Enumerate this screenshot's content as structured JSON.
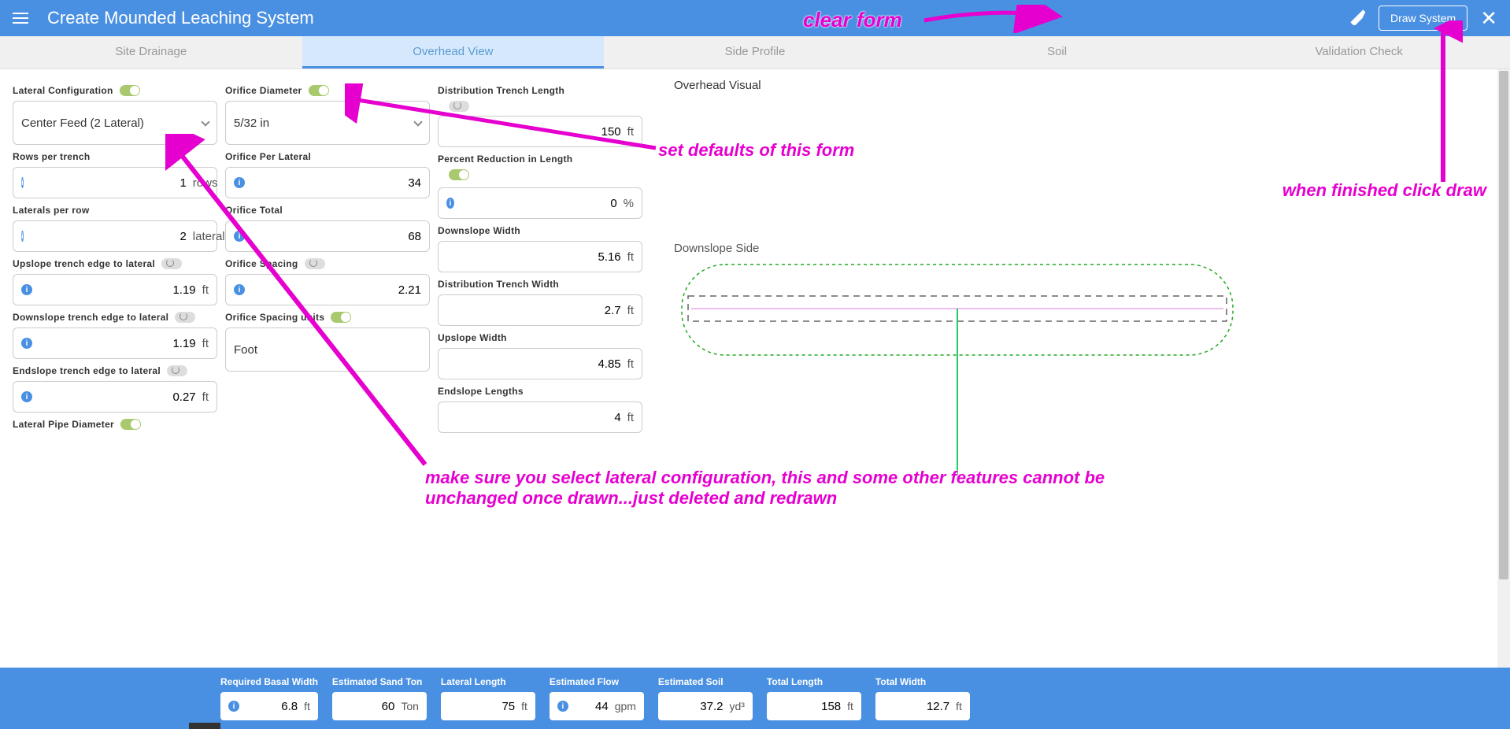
{
  "header": {
    "title": "Create Mounded Leaching System",
    "draw_button": "Draw System"
  },
  "tabs": [
    "Site Drainage",
    "Overhead View",
    "Side Profile",
    "Soil",
    "Validation Check"
  ],
  "active_tab": 1,
  "col1": {
    "lateral_config_label": "Lateral Configuration",
    "lateral_config_value": "Center Feed (2 Lateral)",
    "rows_per_trench_label": "Rows per trench",
    "rows_per_trench_value": "1",
    "rows_per_trench_unit": "rows",
    "laterals_per_row_label": "Laterals per row",
    "laterals_per_row_value": "2",
    "laterals_per_row_unit": "laterals/row",
    "upslope_label": "Upslope trench edge to lateral",
    "upslope_value": "1.19",
    "downslope_label": "Downslope trench edge to lateral",
    "downslope_value": "1.19",
    "endslope_label": "Endslope trench edge to lateral",
    "endslope_value": "0.27",
    "lateral_pipe_label": "Lateral Pipe Diameter",
    "ft": "ft"
  },
  "col2": {
    "orifice_diameter_label": "Orifice Diameter",
    "orifice_diameter_value": "5/32 in",
    "orifice_per_lateral_label": "Orifice Per Lateral",
    "orifice_per_lateral_value": "34",
    "orifice_total_label": "Orifice Total",
    "orifice_total_value": "68",
    "orifice_spacing_label": "Orifice Spacing",
    "orifice_spacing_value": "2.21",
    "orifice_spacing_units_label": "Orifice Spacing units",
    "orifice_spacing_units_value": "Foot"
  },
  "col3": {
    "dist_trench_len_label": "Distribution Trench Length",
    "dist_trench_len_value": "150",
    "dist_trench_len_unit": "ft",
    "percent_red_label": "Percent Reduction in Length",
    "percent_red_value": "0",
    "percent_red_unit": "%",
    "downslope_width_label": "Downslope Width",
    "downslope_width_value": "5.16",
    "dist_trench_width_label": "Distribution Trench Width",
    "dist_trench_width_value": "2.7",
    "upslope_width_label": "Upslope Width",
    "upslope_width_value": "4.85",
    "endslope_len_label": "Endslope Lengths",
    "endslope_len_value": "4",
    "ft": "ft"
  },
  "overhead": {
    "title": "Overhead Visual",
    "downslope_side": "Downslope Side"
  },
  "metrics": [
    {
      "label": "Required Basal Width",
      "value": "6.8",
      "unit": "ft",
      "info": true
    },
    {
      "label": "Estimated Sand Ton",
      "value": "60",
      "unit": "Ton",
      "info": false
    },
    {
      "label": "Lateral Length",
      "value": "75",
      "unit": "ft",
      "info": false
    },
    {
      "label": "Estimated Flow",
      "value": "44",
      "unit": "gpm",
      "info": true
    },
    {
      "label": "Estimated Soil",
      "value": "37.2",
      "unit": "yd³",
      "info": false
    },
    {
      "label": "Total Length",
      "value": "158",
      "unit": "ft",
      "info": false
    },
    {
      "label": "Total Width",
      "value": "12.7",
      "unit": "ft",
      "info": false
    }
  ],
  "annotations": {
    "clear_form": "clear form",
    "set_defaults": "set defaults of this form",
    "when_finished": "when finished click draw",
    "lateral_warning": "make sure you select lateral configuration, this and some other features cannot be unchanged once drawn...just deleted and redrawn"
  }
}
